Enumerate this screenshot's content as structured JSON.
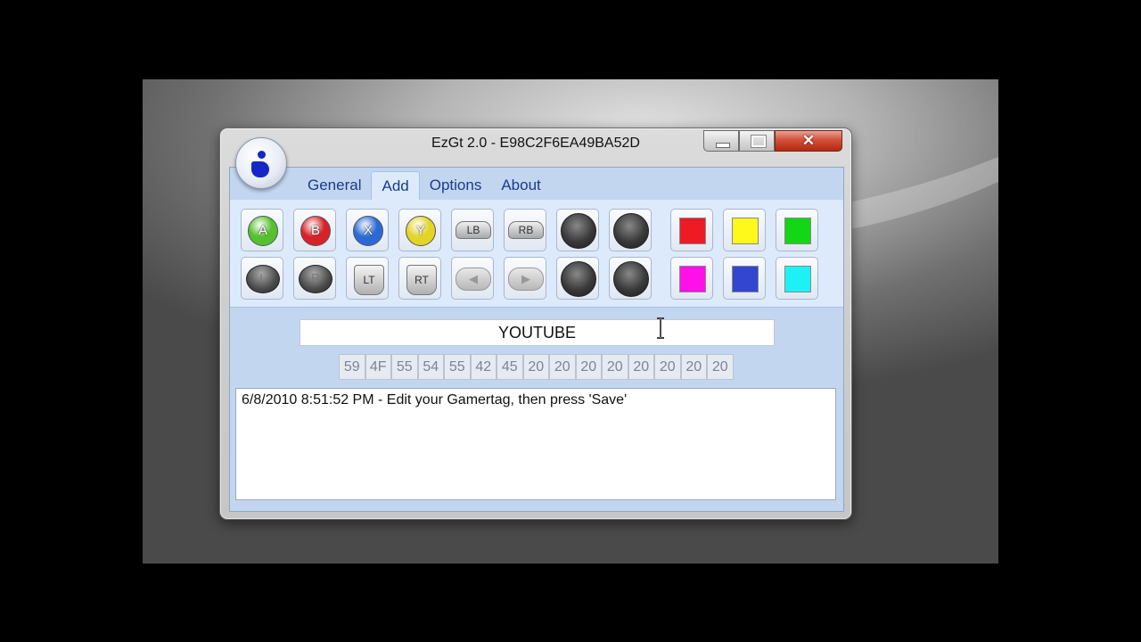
{
  "window": {
    "title": "EzGt 2.0 - E98C2F6EA49BA52D",
    "close_glyph": "✕"
  },
  "tabs": [
    {
      "label": "General",
      "active": false
    },
    {
      "label": "Add",
      "active": true
    },
    {
      "label": "Options",
      "active": false
    },
    {
      "label": "About",
      "active": false
    }
  ],
  "toolbar": {
    "row1": [
      {
        "name": "a-button-icon",
        "label": "A",
        "color": "#54c22e"
      },
      {
        "name": "b-button-icon",
        "label": "B",
        "color": "#d8222a"
      },
      {
        "name": "x-button-icon",
        "label": "X",
        "color": "#2b6ad6"
      },
      {
        "name": "y-button-icon",
        "label": "Y",
        "color": "#e3d426"
      },
      {
        "name": "lb-bumper-icon",
        "label": "LB"
      },
      {
        "name": "rb-bumper-icon",
        "label": "RB"
      },
      {
        "name": "left-stick-icon",
        "label": ""
      },
      {
        "name": "right-stick-icon",
        "label": ""
      }
    ],
    "row2": [
      {
        "name": "left-thumb-icon",
        "label": "L"
      },
      {
        "name": "right-thumb-icon",
        "label": "R"
      },
      {
        "name": "lt-trigger-icon",
        "label": "LT"
      },
      {
        "name": "rt-trigger-icon",
        "label": "RT"
      },
      {
        "name": "dpad-left-icon",
        "label": "◀"
      },
      {
        "name": "dpad-right-icon",
        "label": "▶"
      },
      {
        "name": "stick-down-icon",
        "label": ""
      },
      {
        "name": "stick-up-icon",
        "label": ""
      }
    ],
    "colors_row1": [
      "#ee1b25",
      "#fff81a",
      "#13d617"
    ],
    "colors_row2": [
      "#ff10e9",
      "#3346cf",
      "#1cf2f6"
    ]
  },
  "gamertag": {
    "value": "YOUTUBE"
  },
  "hex_bytes": [
    "59",
    "4F",
    "55",
    "54",
    "55",
    "42",
    "45",
    "20",
    "20",
    "20",
    "20",
    "20",
    "20",
    "20",
    "20"
  ],
  "log": {
    "text": "6/8/2010 8:51:52 PM - Edit your Gamertag, then press 'Save'"
  }
}
